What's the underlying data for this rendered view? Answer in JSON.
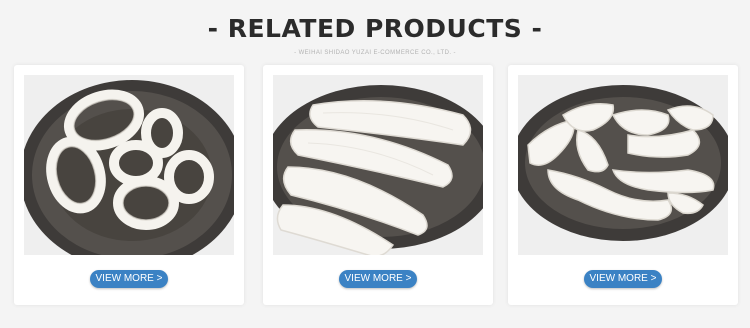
{
  "section": {
    "title": "- RELATED PRODUCTS -",
    "subtitle": "- WEIHAI SHIDAO YUZAI E-COMMERCE CO., LTD. -"
  },
  "products": [
    {
      "button_label": "VIEW MORE >",
      "image_icon": "squid-rings-photo"
    },
    {
      "button_label": "VIEW MORE >",
      "image_icon": "squid-tubes-photo"
    },
    {
      "button_label": "VIEW MORE >",
      "image_icon": "squid-strips-photo"
    }
  ],
  "colors": {
    "background": "#f4f4f4",
    "button": "#3b82c4",
    "title": "#2b2b2b",
    "plate": "#4a4744"
  }
}
